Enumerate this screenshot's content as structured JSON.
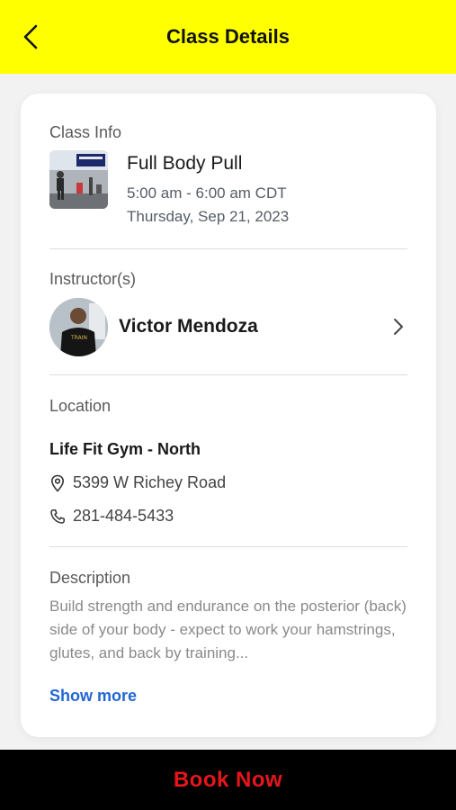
{
  "header": {
    "title": "Class Details",
    "back_icon": "chevron-left-icon",
    "background": "#ffff00"
  },
  "class_info": {
    "section_label": "Class Info",
    "title": "Full Body Pull",
    "time": "5:00 am - 6:00 am CDT",
    "date": "Thursday, Sep 21, 2023"
  },
  "instructor": {
    "section_label": "Instructor(s)",
    "name": "Victor Mendoza",
    "shirt_text": "TRAIN"
  },
  "location": {
    "section_label": "Location",
    "gym_name": "Life Fit Gym - North",
    "address": "5399 W Richey Road",
    "phone": "281-484-5433"
  },
  "description": {
    "section_label": "Description",
    "text": "Build strength and endurance on the posterior (back) side of your body - expect to work your hamstrings, glutes, and back by training...",
    "show_more": "Show more"
  },
  "footer": {
    "book_label": "Book Now",
    "accent": "#e8151b"
  }
}
